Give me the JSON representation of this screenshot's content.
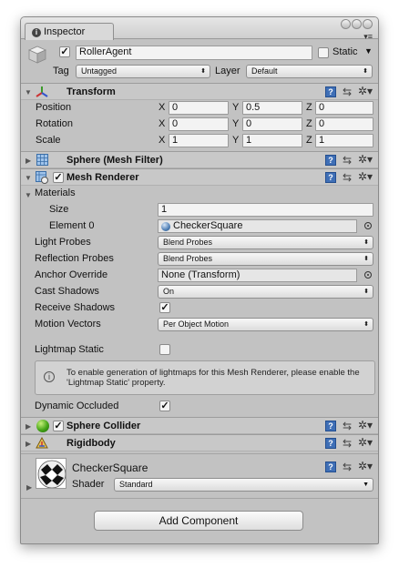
{
  "window": {
    "tab_label": "Inspector",
    "tab_menu_glyph": "▾≡",
    "icons": [
      "info-icon",
      "window-button-icon"
    ]
  },
  "gameobject": {
    "name": "RollerAgent",
    "active": true,
    "static_label": "Static",
    "static_checked": false,
    "tag_label": "Tag",
    "tag_value": "Untagged",
    "layer_label": "Layer",
    "layer_value": "Default"
  },
  "transform": {
    "title": "Transform",
    "rows": [
      {
        "label": "Position",
        "x": "0",
        "y": "0.5",
        "z": "0"
      },
      {
        "label": "Rotation",
        "x": "0",
        "y": "0",
        "z": "0"
      },
      {
        "label": "Scale",
        "x": "1",
        "y": "1",
        "z": "1"
      }
    ],
    "axis": {
      "x": "X",
      "y": "Y",
      "z": "Z"
    }
  },
  "mesh_filter": {
    "title": "Sphere (Mesh Filter)"
  },
  "mesh_renderer": {
    "title": "Mesh Renderer",
    "enabled": true,
    "materials_label": "Materials",
    "size_label": "Size",
    "size_value": "1",
    "element0_label": "Element 0",
    "element0_value": "CheckerSquare",
    "light_probes_label": "Light Probes",
    "light_probes_value": "Blend Probes",
    "reflection_probes_label": "Reflection Probes",
    "reflection_probes_value": "Blend Probes",
    "anchor_override_label": "Anchor Override",
    "anchor_override_value": "None (Transform)",
    "cast_shadows_label": "Cast Shadows",
    "cast_shadows_value": "On",
    "receive_shadows_label": "Receive Shadows",
    "receive_shadows_checked": true,
    "motion_vectors_label": "Motion Vectors",
    "motion_vectors_value": "Per Object Motion",
    "lightmap_static_label": "Lightmap Static",
    "lightmap_static_checked": false,
    "info_text": "To enable generation of lightmaps for this Mesh Renderer, please enable the 'Lightmap Static' property.",
    "dynamic_occluded_label": "Dynamic Occluded",
    "dynamic_occluded_checked": true
  },
  "sphere_collider": {
    "title": "Sphere Collider",
    "enabled": true
  },
  "rigidbody": {
    "title": "Rigidbody"
  },
  "material": {
    "name": "CheckerSquare",
    "shader_label": "Shader",
    "shader_value": "Standard"
  },
  "add_component_label": "Add Component",
  "glyphs": {
    "check": "✓",
    "dropdown_arrow": "⬍",
    "help": "?",
    "preset": "⇆",
    "gear": "✲▾",
    "fold_open": "▼",
    "fold_closed": "▶"
  },
  "colors": {
    "window_bg": "#c2c2c2",
    "help_icon": "#3f6fb6",
    "collider_sphere": "#44a417"
  }
}
